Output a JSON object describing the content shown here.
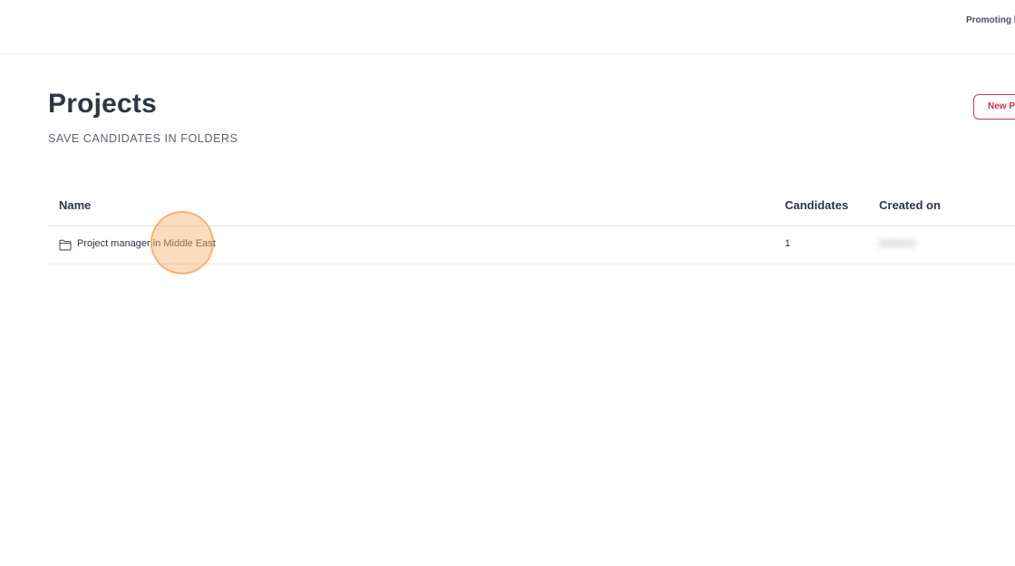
{
  "header": {
    "org_name": "Promoting b"
  },
  "page": {
    "title": "Projects",
    "subtitle": "SAVE CANDIDATES IN FOLDERS",
    "new_button_label": "New P"
  },
  "table": {
    "columns": {
      "name": "Name",
      "candidates": "Candidates",
      "created_on": "Created on"
    },
    "rows": [
      {
        "icon": "folder-icon",
        "name": "Project manager in Middle East",
        "candidates": "1",
        "created_on": "●●●●●●"
      }
    ]
  },
  "colors": {
    "accent": "#d0304f",
    "title": "#2c3645",
    "click_marker": "#f8b26e"
  }
}
